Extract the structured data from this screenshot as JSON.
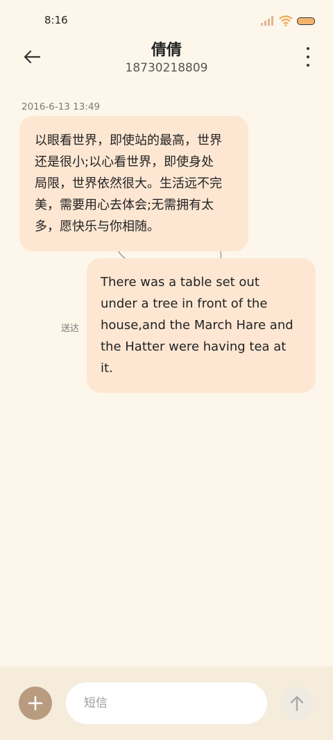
{
  "status_bar": {
    "time": "8:16",
    "icons": [
      "signal-icon",
      "wifi-icon",
      "battery-icon"
    ],
    "battery_color": "#f3b36c"
  },
  "header": {
    "contact_name": "倩倩",
    "contact_number": "18730218809",
    "back_icon": "back-arrow-icon",
    "more_icon": "more-vertical-icon"
  },
  "conversation": {
    "timestamp": "2016-6-13 13:49",
    "messages": [
      {
        "direction": "incoming",
        "lines": [
          "以眼看世界，即使站的最高，世界",
          "还是很小;以心看世界，即使身处",
          "局限，世界依然很大。生活远不完",
          "美，需要用心去体会;无需拥有太",
          "多，愿快乐与你相随。"
        ]
      },
      {
        "direction": "outgoing",
        "status": "送达",
        "lines": [
          "There was a table set out",
          "under a tree in front of the",
          "house,and the March Hare and",
          "the Hatter were having tea at",
          "it."
        ]
      }
    ],
    "bubble_color": "#fde7d3",
    "background_color": "#fdf6ea"
  },
  "composer": {
    "placeholder": "短信",
    "value": "",
    "add_icon": "plus-icon",
    "send_icon": "arrow-up-icon",
    "add_button_color": "#b99b80",
    "send_button_color": "#efeae2"
  }
}
